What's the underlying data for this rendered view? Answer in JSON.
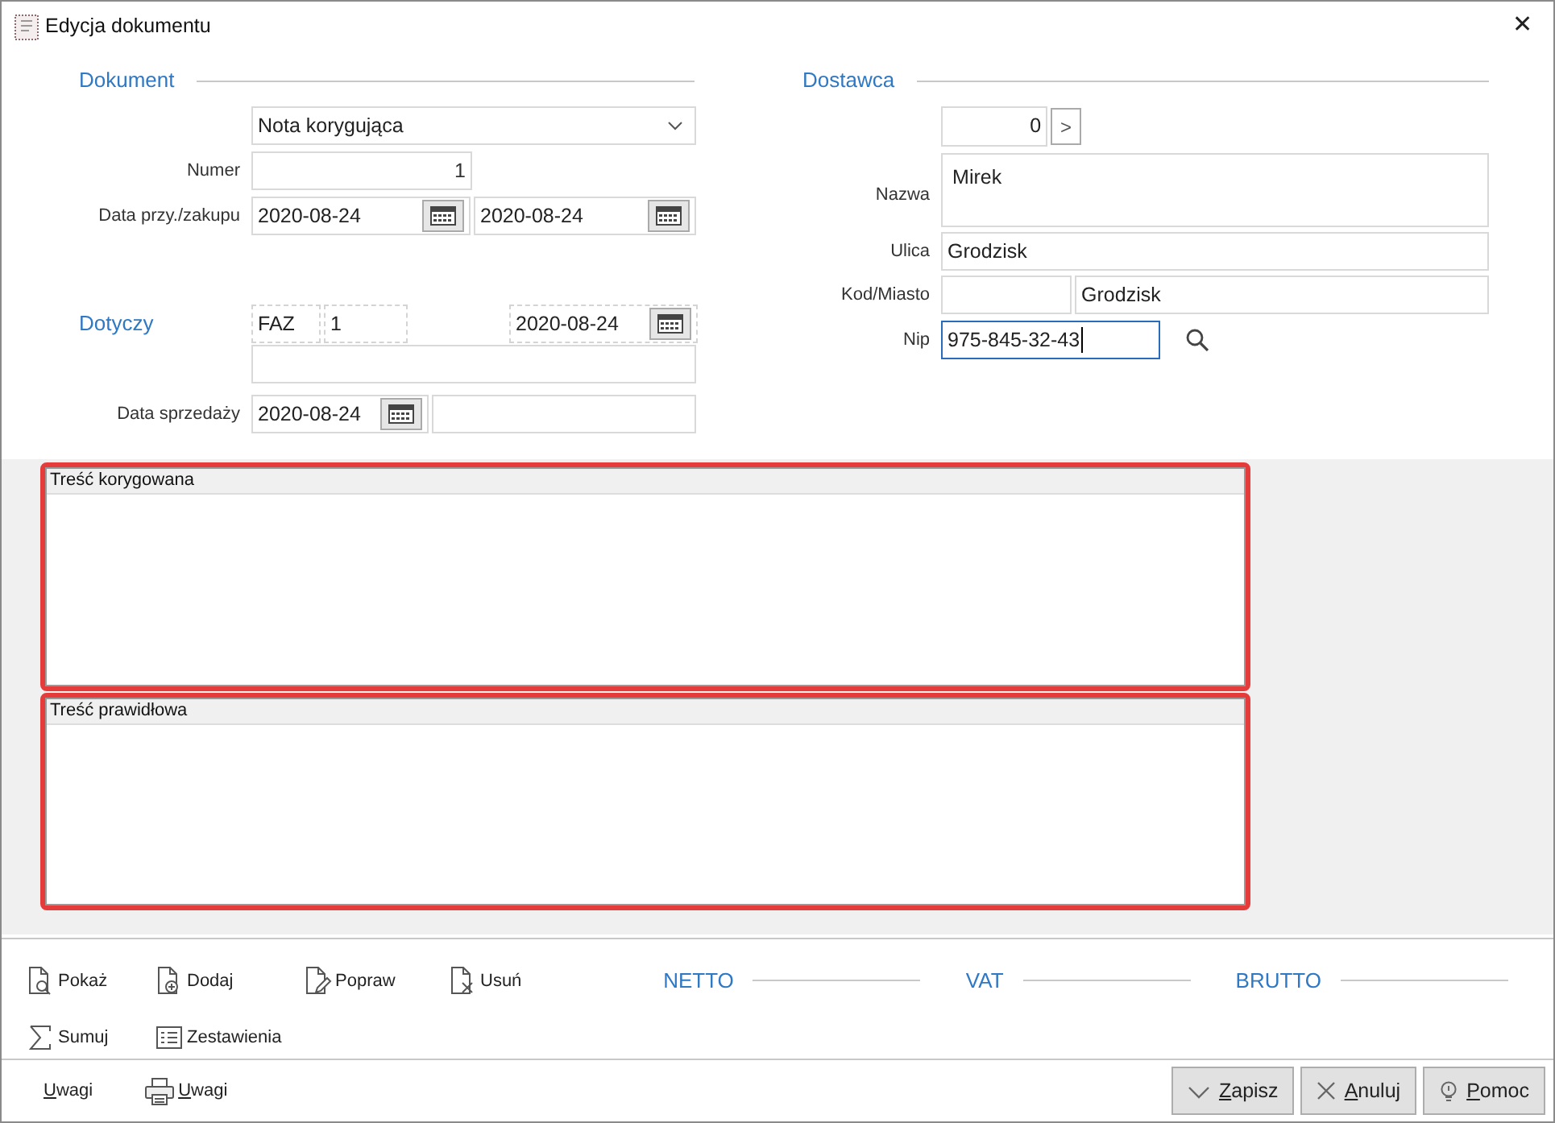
{
  "window": {
    "title": "Edycja dokumentu",
    "close": "✕"
  },
  "dokument": {
    "heading": "Dokument",
    "document_type": "Nota korygująca",
    "numer_label": "Numer",
    "numer": "1",
    "date_label": "Data przy./zakupu",
    "dates": [
      "2020-08-24",
      "2020-08-24"
    ]
  },
  "dotyczy": {
    "heading": "Dotyczy",
    "prefix": "FAZ",
    "number": "1",
    "date": "2020-08-24",
    "sale_date_label": "Data sprzedaży",
    "sale_date": "2020-08-24"
  },
  "dostawca": {
    "heading": "Dostawca",
    "counter": "0",
    "counter_button": ">",
    "nazwa_label": "Nazwa",
    "nazwa": "Mirek",
    "ulica_label": "Ulica",
    "ulica": "Grodzisk",
    "kod_miasto_label": "Kod/Miasto",
    "miasto": "Grodzisk",
    "nip_label": "Nip",
    "nip": "975-845-32-43",
    "nip_focused": true
  },
  "panels": [
    {
      "title": "Treść korygowana",
      "highlighted": true
    },
    {
      "title": "Treść prawidłowa",
      "highlighted": true
    }
  ],
  "toolbar": [
    {
      "label": "Pokaż",
      "kind": "view"
    },
    {
      "label": "Dodaj",
      "kind": "add"
    },
    {
      "label": "Popraw",
      "kind": "edit"
    },
    {
      "label": "Usuń",
      "kind": "delete"
    },
    {
      "label": "Sumuj",
      "kind": "sum"
    },
    {
      "label": "Zestawienia",
      "kind": "list"
    }
  ],
  "totals": [
    "NETTO",
    "VAT",
    "BRUTTO"
  ],
  "footer_left": [
    {
      "label": "Uwagi",
      "kind": "plain"
    },
    {
      "label": "Uwagi",
      "kind": "print"
    }
  ],
  "footer_buttons": [
    {
      "label": "Zapisz",
      "kind": "save"
    },
    {
      "label": "Anuluj",
      "kind": "cancel"
    },
    {
      "label": "Pomoc",
      "kind": "help"
    }
  ]
}
